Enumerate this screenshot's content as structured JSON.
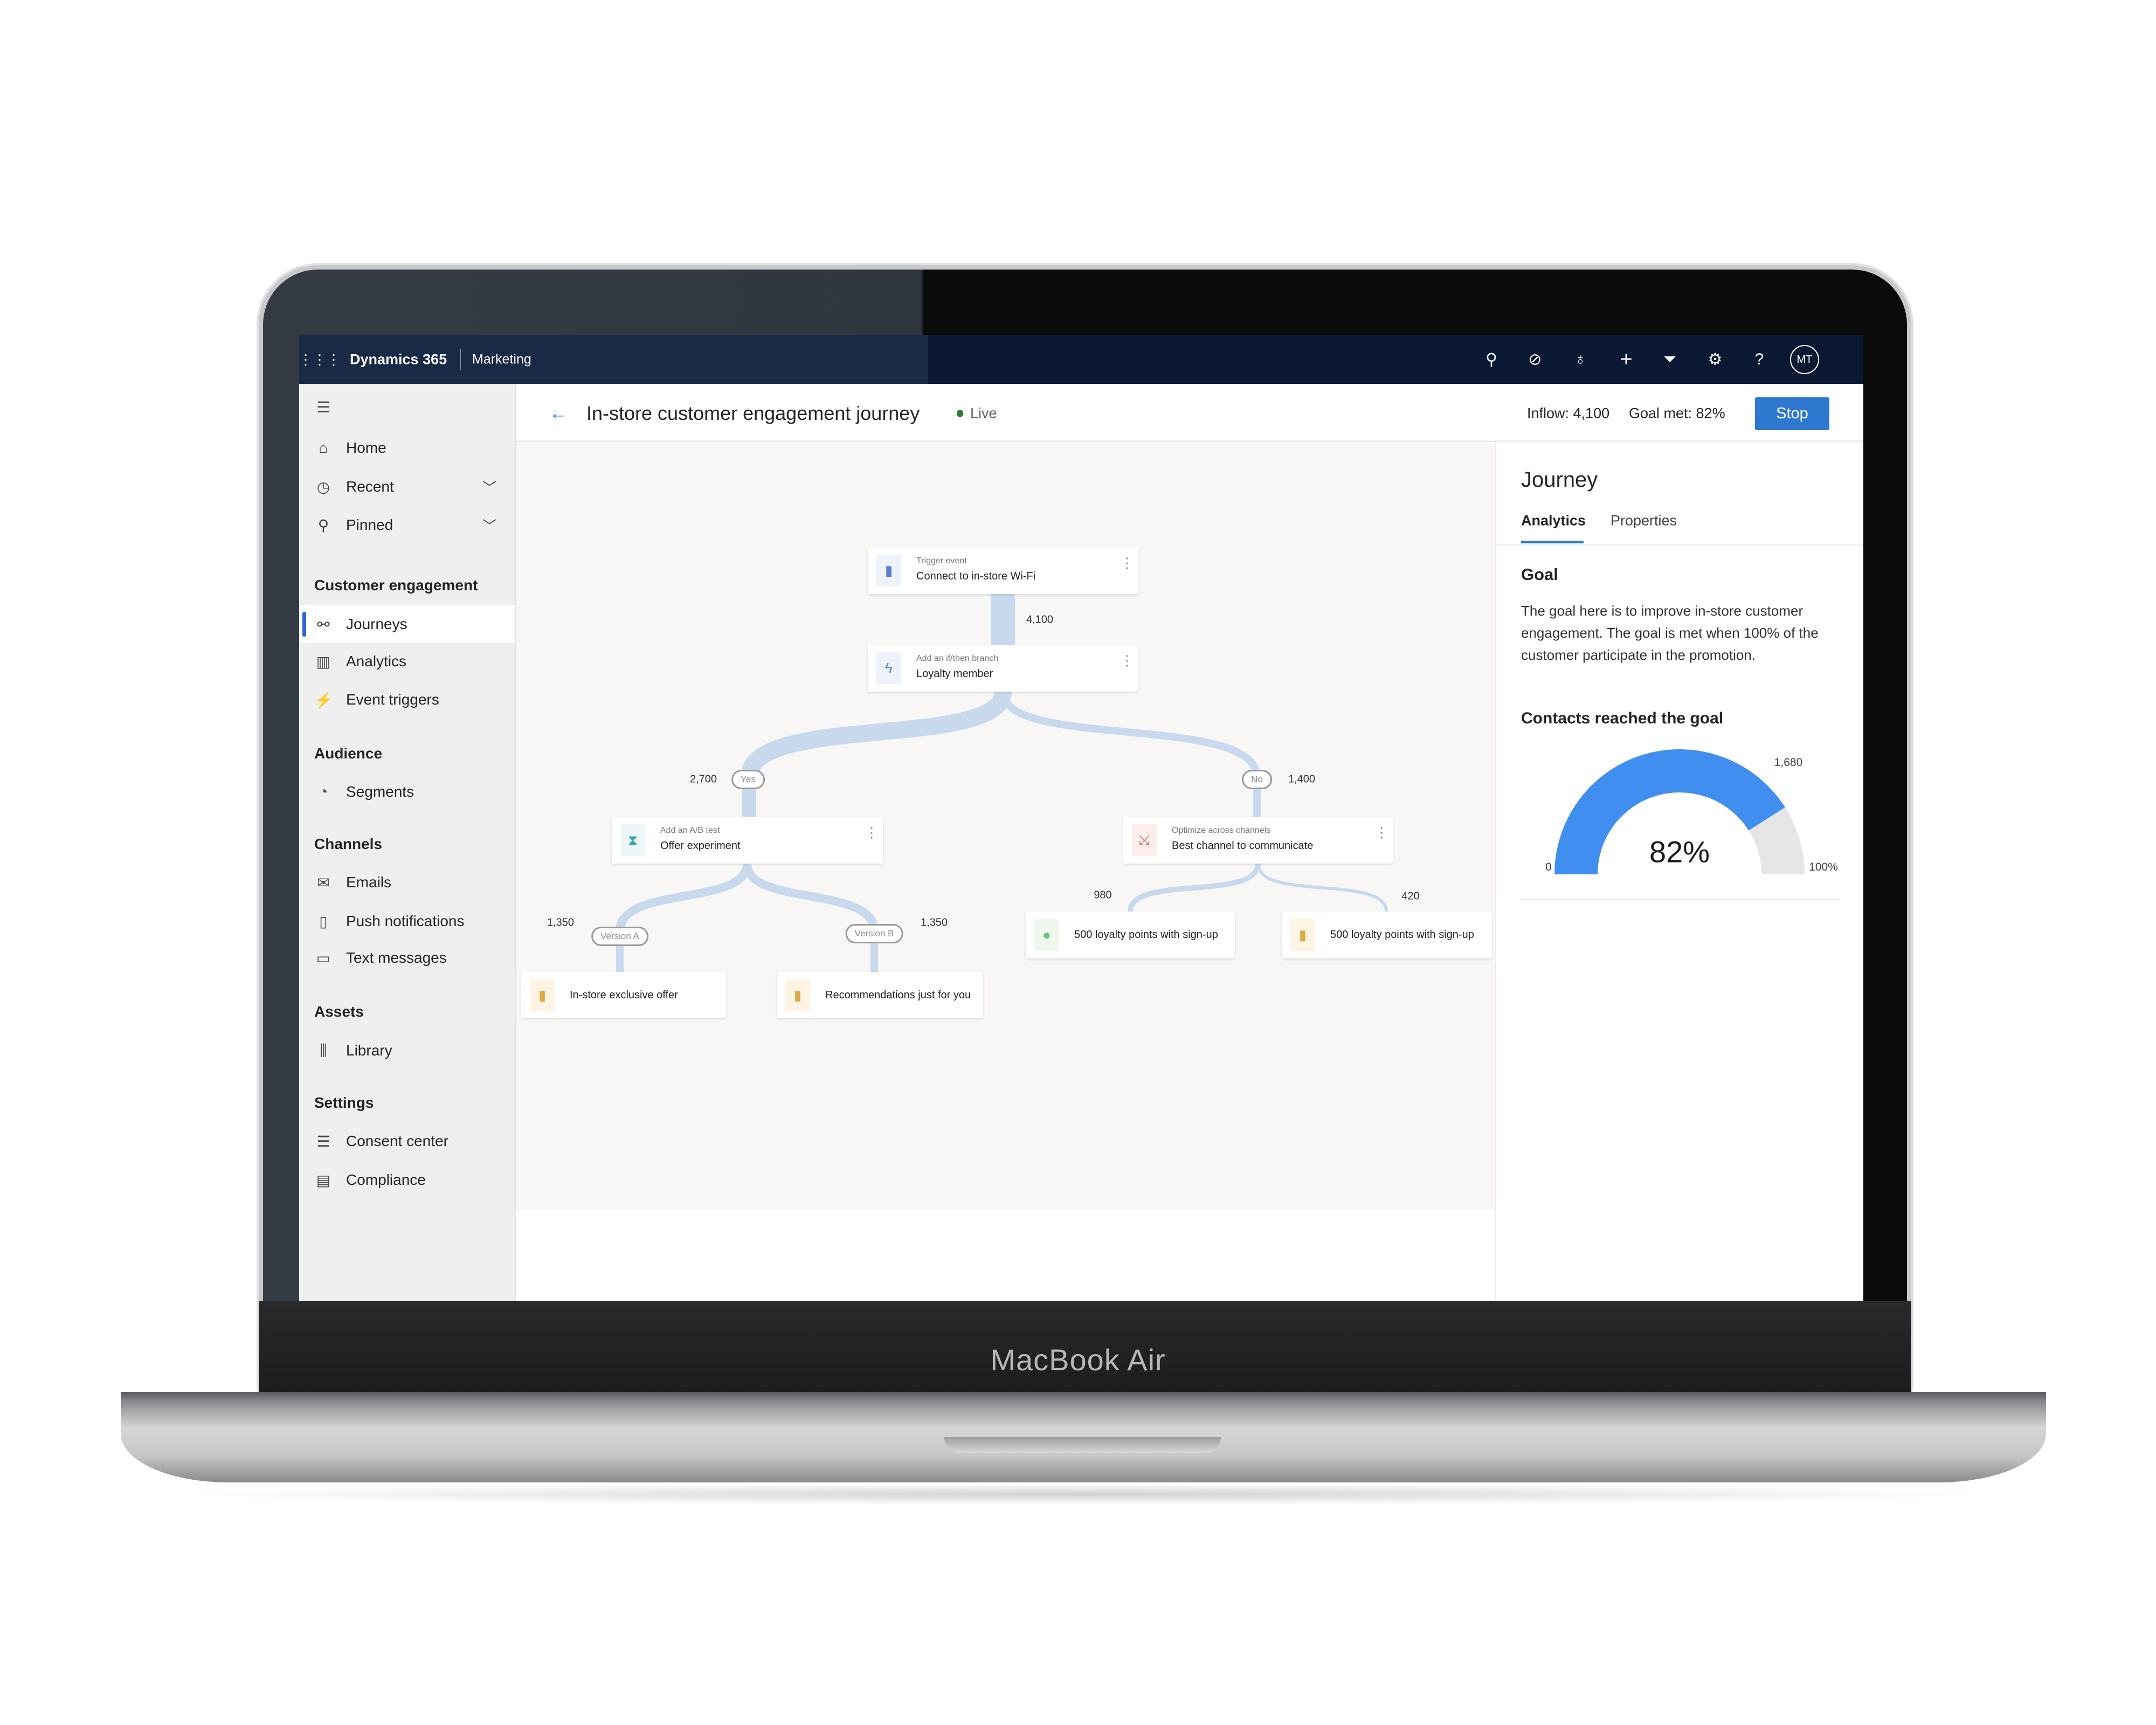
{
  "device_label": "MacBook Air",
  "topbar": {
    "app": "Dynamics 365",
    "module": "Marketing",
    "icons": [
      "search-icon",
      "task-icon",
      "lightbulb-icon",
      "plus-icon",
      "filter-icon",
      "gear-icon",
      "help-icon"
    ],
    "avatar": "MT"
  },
  "sidebar": {
    "items_top": [
      {
        "label": "Home",
        "icon": "home-icon"
      },
      {
        "label": "Recent",
        "icon": "clock-icon"
      },
      {
        "label": "Pinned",
        "icon": "pin-icon"
      }
    ],
    "sections": [
      {
        "title": "Customer engagement",
        "items": [
          {
            "label": "Journeys",
            "selected": true
          },
          {
            "label": "Analytics"
          },
          {
            "label": "Event triggers"
          }
        ]
      },
      {
        "title": "Audience",
        "items": [
          {
            "label": "Segments"
          }
        ]
      },
      {
        "title": "Channels",
        "items": [
          {
            "label": "Emails"
          },
          {
            "label": "Push notifications"
          },
          {
            "label": "Text messages"
          }
        ]
      },
      {
        "title": "Assets",
        "items": [
          {
            "label": "Library"
          }
        ]
      },
      {
        "title": "Settings",
        "items": [
          {
            "label": "Consent center"
          },
          {
            "label": "Compliance"
          }
        ]
      }
    ]
  },
  "header": {
    "title": "In-store customer engagement journey",
    "status": "Live",
    "status_color": "#2e7d32",
    "inflow": "Inflow: 4,100",
    "goal_met": "Goal met: 82%",
    "stop": "Stop"
  },
  "journey": {
    "trigger": {
      "sub": "Trigger event",
      "title": "Connect to in-store Wi-Fi"
    },
    "trigger_count": "4,100",
    "branch": {
      "sub": "Add an if/then branch",
      "title": "Loyalty member"
    },
    "yes": {
      "label": "Yes",
      "count": "2,700"
    },
    "no": {
      "label": "No",
      "count": "1,400"
    },
    "abtest": {
      "sub": "Add an A/B test",
      "title": "Offer experiment"
    },
    "optimize": {
      "sub": "Optimize across channels",
      "title": "Best channel to communicate"
    },
    "version_a": {
      "label": "Version A",
      "count": "1,350"
    },
    "version_b": {
      "label": "Version B",
      "count": "1,350"
    },
    "leaf_a": "In-store exclusive offer",
    "leaf_b": "Recommendations just for you",
    "channel_1": {
      "title": "500 loyalty points with sign-up",
      "count": "980"
    },
    "channel_2": {
      "title": "500 loyalty points with sign-up",
      "count": "420"
    },
    "flow_color": "#c8d9ee"
  },
  "panel": {
    "title": "Journey",
    "tabs": [
      "Analytics",
      "Properties"
    ],
    "goal_heading": "Goal",
    "goal_text": "The goal here is to improve in-store customer engagement. The goal is met when 100% of the customer participate in the promotion.",
    "contacts_heading": "Contacts reached the goal",
    "gauge": {
      "value_percent": 82,
      "center_label": "82%",
      "min_label": "0",
      "max_label": "100%",
      "target_label": "1,680",
      "fill_color": "#3f8ef0",
      "track_color": "#e6e6e6"
    }
  }
}
